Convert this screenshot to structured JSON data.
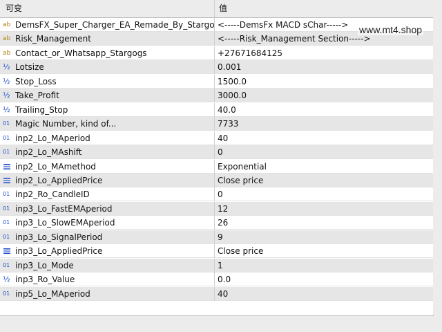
{
  "header": {
    "col_name": "可变",
    "col_value": "值"
  },
  "watermark": "www.mt4.shop",
  "rows": [
    {
      "icon": "ab",
      "name": "DemsFX_Super_Charger_EA_Remade_By_Stargogs",
      "value": "<-----DemsFx MACD sChar----->"
    },
    {
      "icon": "ab",
      "name": "Risk_Management",
      "value": "<-----Risk_Management Section----->"
    },
    {
      "icon": "ab",
      "name": "Contact_or_Whatsapp_Stargogs",
      "value": "+27671684125"
    },
    {
      "icon": "half",
      "name": "Lotsize",
      "value": "0.001"
    },
    {
      "icon": "half",
      "name": "Stop_Loss",
      "value": "1500.0"
    },
    {
      "icon": "half",
      "name": "Take_Profit",
      "value": "3000.0"
    },
    {
      "icon": "half",
      "name": "Trailing_Stop",
      "value": "40.0"
    },
    {
      "icon": "num",
      "name": "Magic Number, kind of...",
      "value": "7733"
    },
    {
      "icon": "num",
      "name": "inp2_Lo_MAperiod",
      "value": "40"
    },
    {
      "icon": "num",
      "name": "inp2_Lo_MAshift",
      "value": "0"
    },
    {
      "icon": "enum",
      "name": "inp2_Lo_MAmethod",
      "value": "Exponential"
    },
    {
      "icon": "enum",
      "name": "inp2_Lo_AppliedPrice",
      "value": "Close price"
    },
    {
      "icon": "num",
      "name": "inp2_Ro_CandleID",
      "value": "0"
    },
    {
      "icon": "num",
      "name": "inp3_Lo_FastEMAperiod",
      "value": "12"
    },
    {
      "icon": "num",
      "name": "inp3_Lo_SlowEMAperiod",
      "value": "26"
    },
    {
      "icon": "num",
      "name": "inp3_Lo_SignalPeriod",
      "value": "9"
    },
    {
      "icon": "enum",
      "name": "inp3_Lo_AppliedPrice",
      "value": "Close price"
    },
    {
      "icon": "num",
      "name": "inp3_Lo_Mode",
      "value": "1"
    },
    {
      "icon": "half",
      "name": "inp3_Ro_Value",
      "value": "0.0"
    },
    {
      "icon": "num",
      "name": "inp5_Lo_MAperiod",
      "value": "40"
    }
  ],
  "icon_glyphs": {
    "ab": "ab",
    "half": "½",
    "num": "01"
  }
}
